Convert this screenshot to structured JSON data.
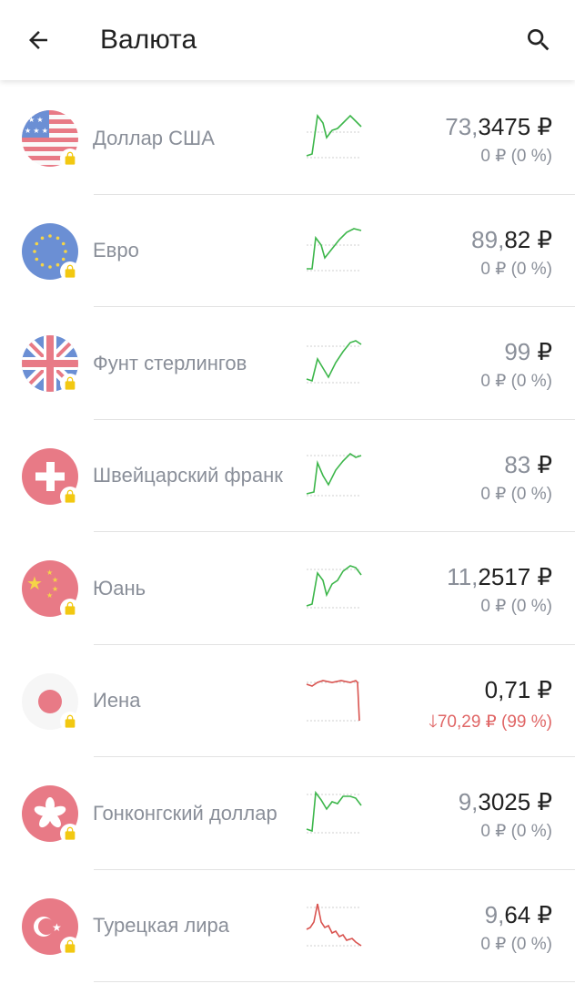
{
  "header": {
    "title": "Валюта",
    "back_icon": "arrow-left-icon",
    "search_icon": "search-icon"
  },
  "colors": {
    "up": "#3cb64a",
    "down": "#d9534f",
    "muted": "#8a8f99",
    "lock": "#f2c811"
  },
  "currencies": [
    {
      "name": "Доллар США",
      "flag": "us-flag-icon",
      "trend": "up",
      "rate_int": "73,",
      "rate_frac": "3475 ₽",
      "change": "0 ₽ (0 %)"
    },
    {
      "name": "Евро",
      "flag": "eu-flag-icon",
      "trend": "up",
      "rate_int": "89,",
      "rate_frac": "82 ₽",
      "change": "0 ₽ (0 %)"
    },
    {
      "name": "Фунт стерлингов",
      "flag": "uk-flag-icon",
      "trend": "up",
      "rate_int": "99",
      "rate_frac": " ₽",
      "change": "0 ₽ (0 %)"
    },
    {
      "name": "Швейцарский франк",
      "flag": "ch-flag-icon",
      "trend": "up",
      "rate_int": "83",
      "rate_frac": " ₽",
      "change": "0 ₽ (0 %)"
    },
    {
      "name": "Юань",
      "flag": "cn-flag-icon",
      "trend": "up",
      "rate_int": "11,",
      "rate_frac": "2517 ₽",
      "change": "0 ₽ (0 %)"
    },
    {
      "name": "Иена",
      "flag": "jp-flag-icon",
      "trend": "down",
      "rate_int": "0,",
      "rate_frac": "71 ₽",
      "change": "70,29 ₽ (99 %)"
    },
    {
      "name": "Гонконгский доллар",
      "flag": "hk-flag-icon",
      "trend": "up",
      "rate_int": "9,",
      "rate_frac": "3025 ₽",
      "change": "0 ₽ (0 %)"
    },
    {
      "name": "Турецкая лира",
      "flag": "tr-flag-icon",
      "trend": "down",
      "rate_int": "9,",
      "rate_frac": "64 ₽",
      "change": "0 ₽ (0 %)"
    }
  ]
}
